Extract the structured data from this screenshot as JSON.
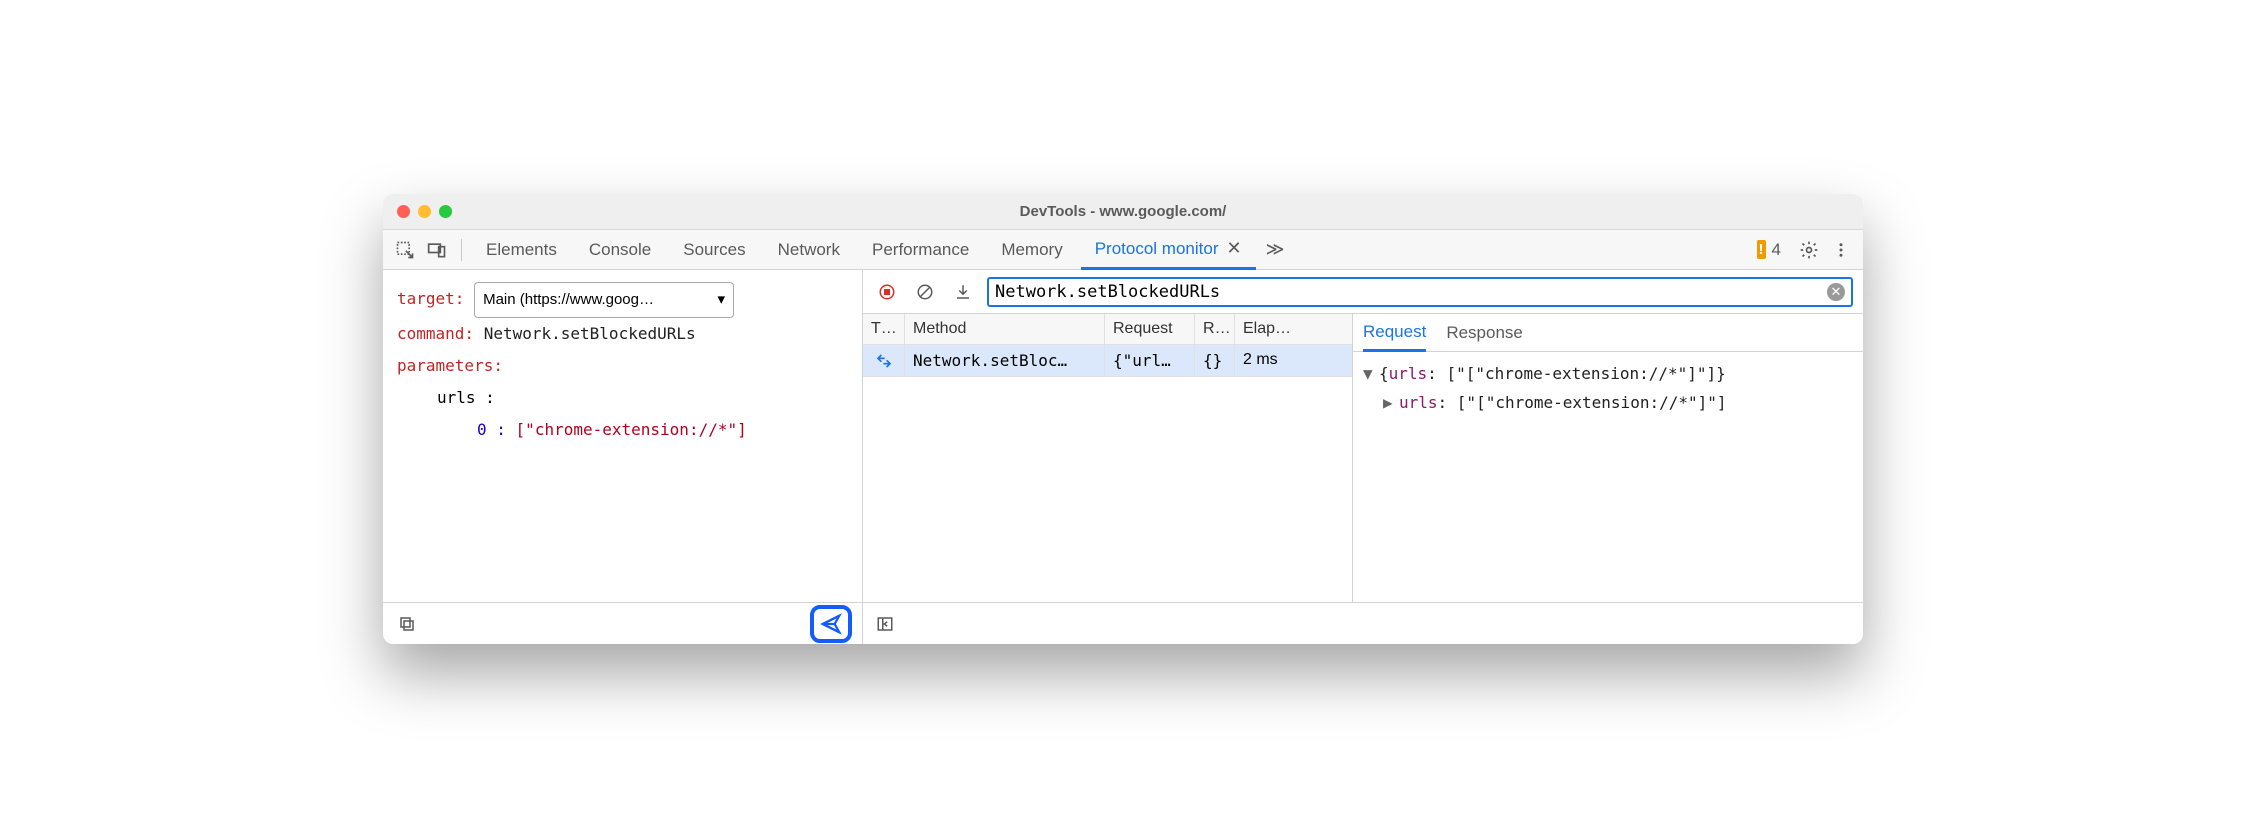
{
  "window": {
    "title": "DevTools - www.google.com/"
  },
  "tabs": {
    "items": [
      "Elements",
      "Console",
      "Sources",
      "Network",
      "Performance",
      "Memory",
      "Protocol monitor"
    ],
    "active": "Protocol monitor"
  },
  "warnings": {
    "count": "4"
  },
  "editor": {
    "target_label": "target:",
    "target_value": "Main (https://www.goog…",
    "command_label": "command:",
    "command_value": "Network.setBlockedURLs",
    "parameters_label": "parameters:",
    "param_key": "urls :",
    "param_idx": "0 :",
    "param_val": "[\"chrome-extension://*\"]"
  },
  "search": {
    "value": "Network.setBlockedURLs"
  },
  "grid": {
    "headers": {
      "t": "T…",
      "method": "Method",
      "request": "Request",
      "r": "R…",
      "elapsed": "Elap…"
    },
    "row": {
      "method": "Network.setBloc…",
      "request": "{\"url…",
      "response": "{}",
      "elapsed": "2 ms"
    }
  },
  "detail": {
    "tabs": {
      "request": "Request",
      "response": "Response"
    },
    "line1_prop": "urls",
    "line1_val": "[\"[\"chrome-extension://*\"]\"]",
    "line2_prop": "urls",
    "line2_val": "[\"[\"chrome-extension://*\"]\"]"
  }
}
